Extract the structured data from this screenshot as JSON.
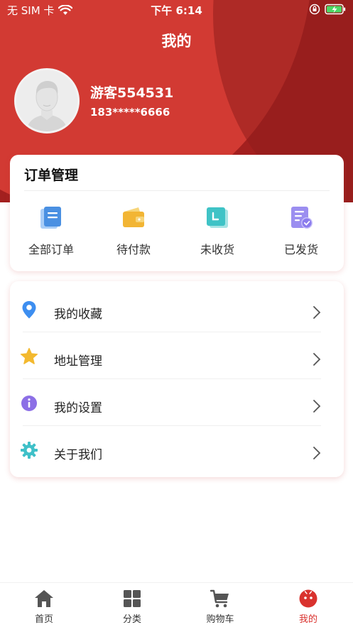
{
  "status_bar": {
    "carrier": "无 SIM 卡",
    "time": "下午 6:14"
  },
  "header": {
    "title": "我的"
  },
  "profile": {
    "username": "游客554531",
    "phone": "183*****6666"
  },
  "orders": {
    "title": "订单管理",
    "items": [
      {
        "label": "全部订单",
        "icon": "document-icon"
      },
      {
        "label": "待付款",
        "icon": "wallet-icon"
      },
      {
        "label": "未收货",
        "icon": "package-icon"
      },
      {
        "label": "已发货",
        "icon": "shipped-check-icon"
      }
    ]
  },
  "menu": {
    "items": [
      {
        "label": "我的收藏",
        "icon": "location-pin-icon"
      },
      {
        "label": "地址管理",
        "icon": "star-icon"
      },
      {
        "label": "我的设置",
        "icon": "info-icon"
      },
      {
        "label": "关于我们",
        "icon": "gear-icon"
      }
    ]
  },
  "tabs": [
    {
      "label": "首页",
      "icon": "home-icon"
    },
    {
      "label": "分类",
      "icon": "grid-icon"
    },
    {
      "label": "购物车",
      "icon": "cart-icon"
    },
    {
      "label": "我的",
      "icon": "profile-face-icon",
      "active": true
    }
  ],
  "colors": {
    "primary": "#d23a33",
    "primary_dark": "#a3201f",
    "active_tab": "#d9322e"
  }
}
